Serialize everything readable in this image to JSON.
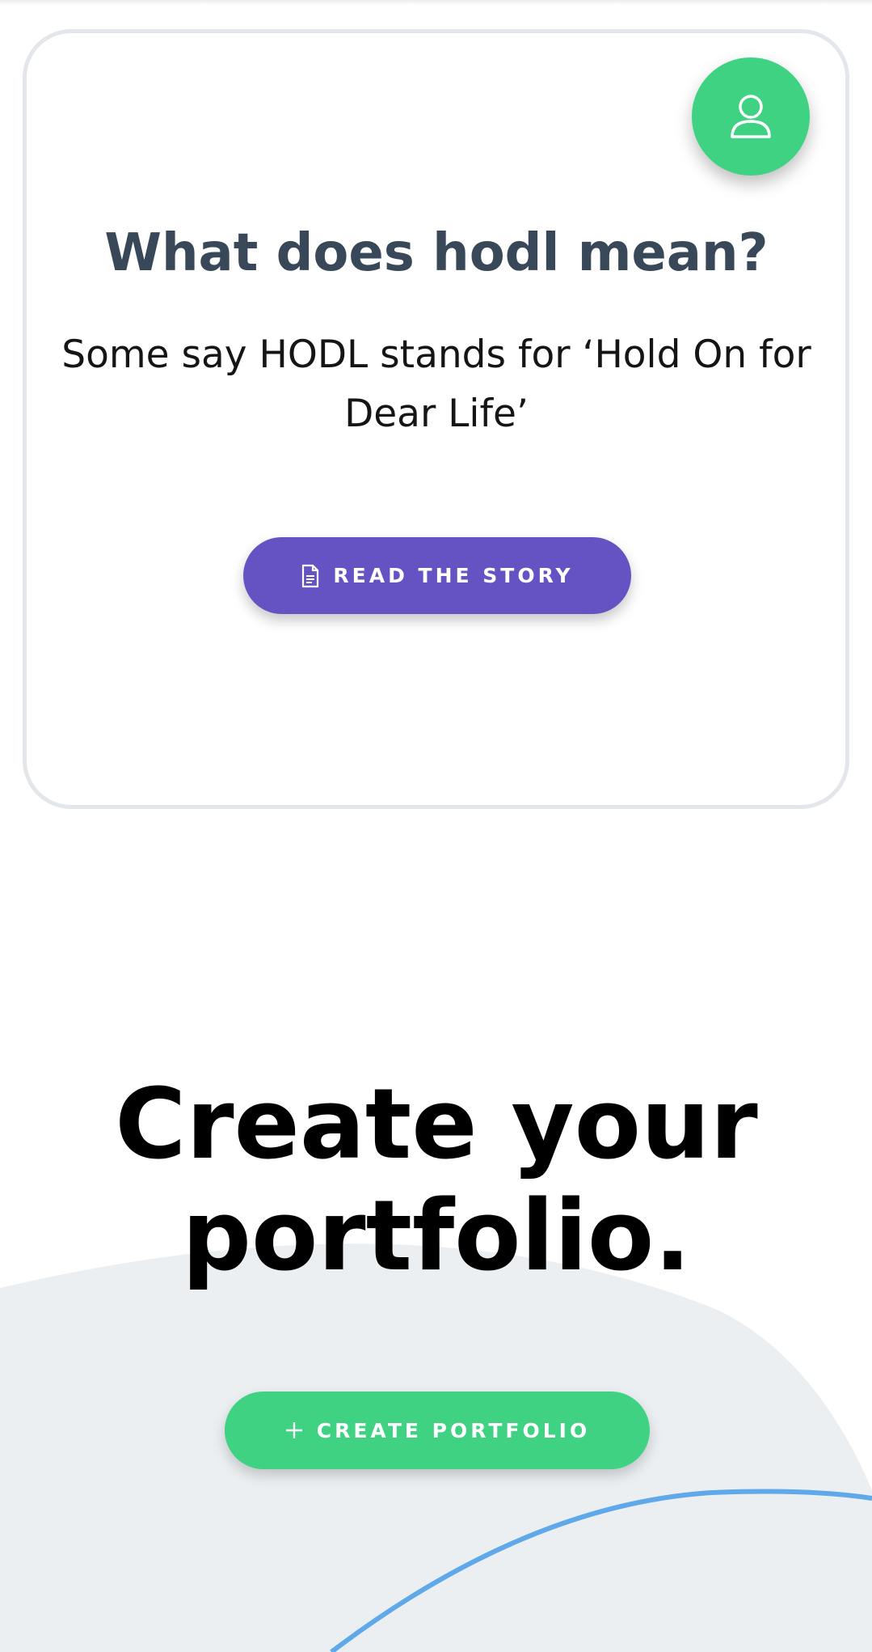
{
  "card": {
    "title": "What does hodl mean?",
    "text": "Some say HODL stands for ‘Hold On for Dear Life’",
    "button_label": "READ THE STORY",
    "button_icon": "document-icon",
    "avatar_icon": "user-icon"
  },
  "portfolio": {
    "title": "Create your portfolio.",
    "button_label": "CREATE PORTFOLIO",
    "button_icon": "plus-icon"
  },
  "colors": {
    "green_accent": "#3fd282",
    "purple_button": "#6653c3",
    "heading_dark": "#384858",
    "background_shape": "#ebeff2",
    "blue_arc": "#5fa8ea"
  }
}
